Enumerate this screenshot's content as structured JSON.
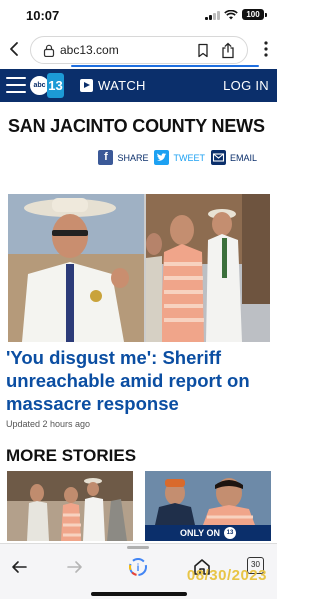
{
  "status_bar": {
    "time": "10:07",
    "battery": "100"
  },
  "browser": {
    "url": "abc13.com"
  },
  "nav": {
    "logo_text": "abc",
    "logo_number": "13",
    "watch_label": "WATCH",
    "login_label": "LOG IN"
  },
  "page": {
    "title": "SAN JACINTO COUNTY NEWS",
    "share": {
      "facebook_label": "SHARE",
      "twitter_label": "TWEET",
      "email_label": "EMAIL"
    },
    "headline": "'You disgust me': Sheriff unreachable amid report on massacre response",
    "updated": "Updated 2 hours ago",
    "more_stories_title": "MORE STORIES",
    "on_air": {
      "prefix": "ONLY ON",
      "logo_number": "13"
    }
  },
  "toolbar": {
    "tab_count": "30"
  },
  "date_stamp": "08/30/2023",
  "colors": {
    "brand_navy": "#0b2f6b",
    "link_blue": "#0b4ea2",
    "twitter_blue": "#1da1f2",
    "facebook_blue": "#3b5998",
    "stamp_yellow": "#e8c547"
  }
}
